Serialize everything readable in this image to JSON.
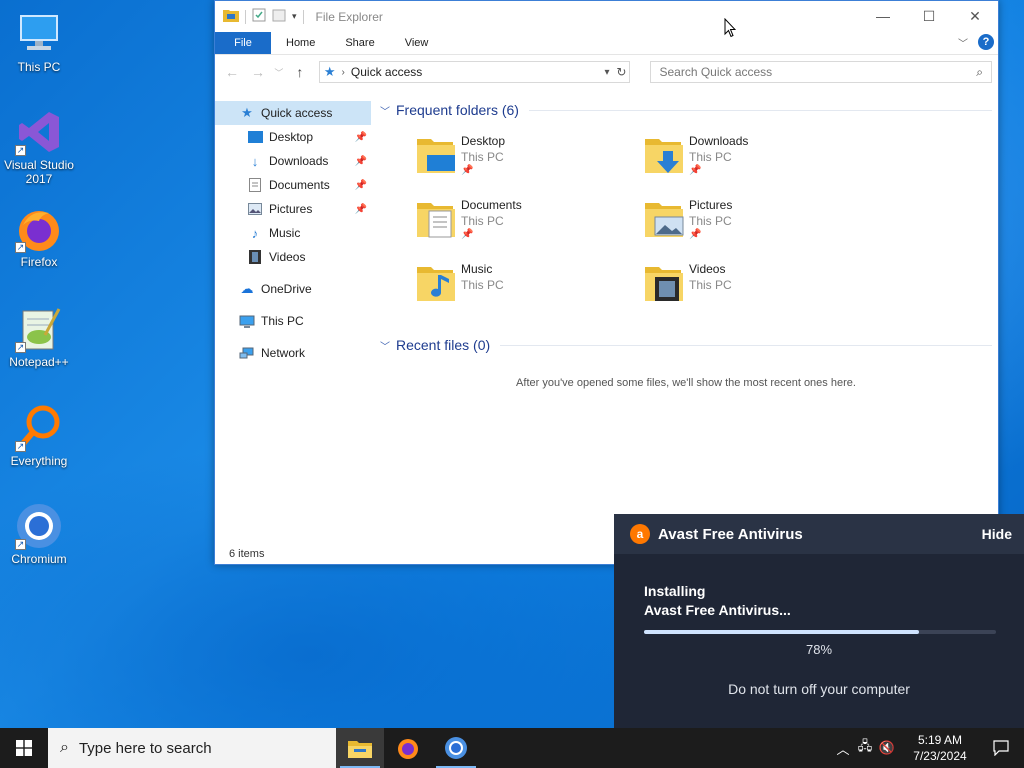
{
  "desktop": {
    "icons": [
      {
        "label": "This PC"
      },
      {
        "label": "Visual Studio 2017"
      },
      {
        "label": "Firefox"
      },
      {
        "label": "Notepad++"
      },
      {
        "label": "Everything"
      },
      {
        "label": "Chromium"
      }
    ]
  },
  "explorer": {
    "title": "File Explorer",
    "ribbon": {
      "tabs": [
        "File",
        "Home",
        "Share",
        "View"
      ]
    },
    "address": {
      "path": "Quick access"
    },
    "search": {
      "placeholder": "Search Quick access"
    },
    "nav": {
      "quick_access": "Quick access",
      "items": [
        {
          "label": "Desktop",
          "pinned": true
        },
        {
          "label": "Downloads",
          "pinned": true
        },
        {
          "label": "Documents",
          "pinned": true
        },
        {
          "label": "Pictures",
          "pinned": true
        },
        {
          "label": "Music",
          "pinned": false
        },
        {
          "label": "Videos",
          "pinned": false
        }
      ],
      "onedrive": "OneDrive",
      "this_pc": "This PC",
      "network": "Network"
    },
    "frequent": {
      "heading": "Frequent folders (6)",
      "folders": [
        {
          "name": "Desktop",
          "location": "This PC",
          "pinned": true
        },
        {
          "name": "Downloads",
          "location": "This PC",
          "pinned": true
        },
        {
          "name": "Documents",
          "location": "This PC",
          "pinned": true
        },
        {
          "name": "Pictures",
          "location": "This PC",
          "pinned": true
        },
        {
          "name": "Music",
          "location": "This PC",
          "pinned": false
        },
        {
          "name": "Videos",
          "location": "This PC",
          "pinned": false
        }
      ]
    },
    "recent": {
      "heading": "Recent files (0)",
      "empty_message": "After you've opened some files, we'll show the most recent ones here."
    },
    "status": "6 items"
  },
  "avast": {
    "title": "Avast Free Antivirus",
    "hide_label": "Hide",
    "status_line1": "Installing",
    "status_line2": "Avast Free Antivirus...",
    "progress_percent": 78,
    "progress_label": "78%",
    "warning": "Do not turn off your computer",
    "colors": {
      "brand": "#ff7800",
      "panel": "#2a3345"
    }
  },
  "taskbar": {
    "search_placeholder": "Type here to search",
    "apps": [
      "file-explorer",
      "firefox",
      "chromium"
    ],
    "clock": {
      "time": "5:19 AM",
      "date": "7/23/2024"
    }
  }
}
